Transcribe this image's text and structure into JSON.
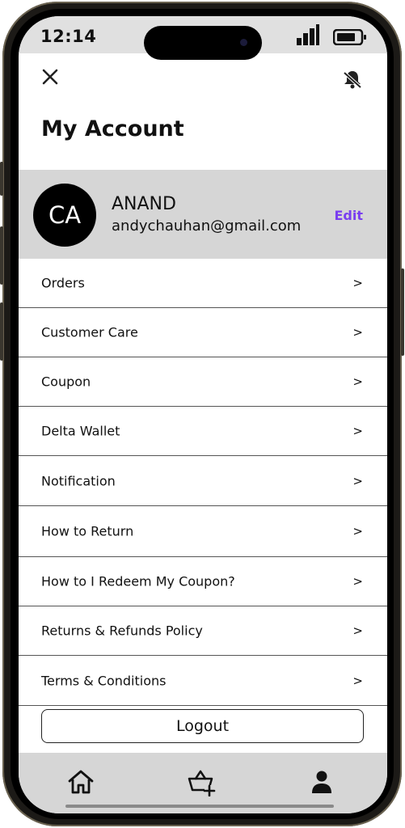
{
  "status_bar": {
    "time": "12:14"
  },
  "header": {
    "title": "My Account"
  },
  "profile": {
    "initials": "CA",
    "name": "ANAND",
    "email": "andychauhan@gmail.com",
    "edit_label": "Edit"
  },
  "menu": [
    {
      "label": "Orders",
      "chevron": ">"
    },
    {
      "label": "Customer Care",
      "chevron": ">"
    },
    {
      "label": "Coupon",
      "chevron": ">"
    },
    {
      "label": "Delta Wallet",
      "chevron": ">"
    },
    {
      "label": "Notification",
      "chevron": ">"
    },
    {
      "label": "How to Return",
      "chevron": ">"
    },
    {
      "label": "How to I Redeem My Coupon?",
      "chevron": ">"
    },
    {
      "label": "Returns & Refunds Policy",
      "chevron": ">"
    },
    {
      "label": "Terms & Conditions",
      "chevron": ">"
    }
  ],
  "logout_label": "Logout",
  "icons": {
    "close": "close-icon",
    "notifications": "bell-muted-icon",
    "home": "home-icon",
    "cart": "basket-add-icon",
    "profile": "user-icon"
  },
  "colors": {
    "accent": "#7a3ef0",
    "panel": "#d6d6d6"
  }
}
